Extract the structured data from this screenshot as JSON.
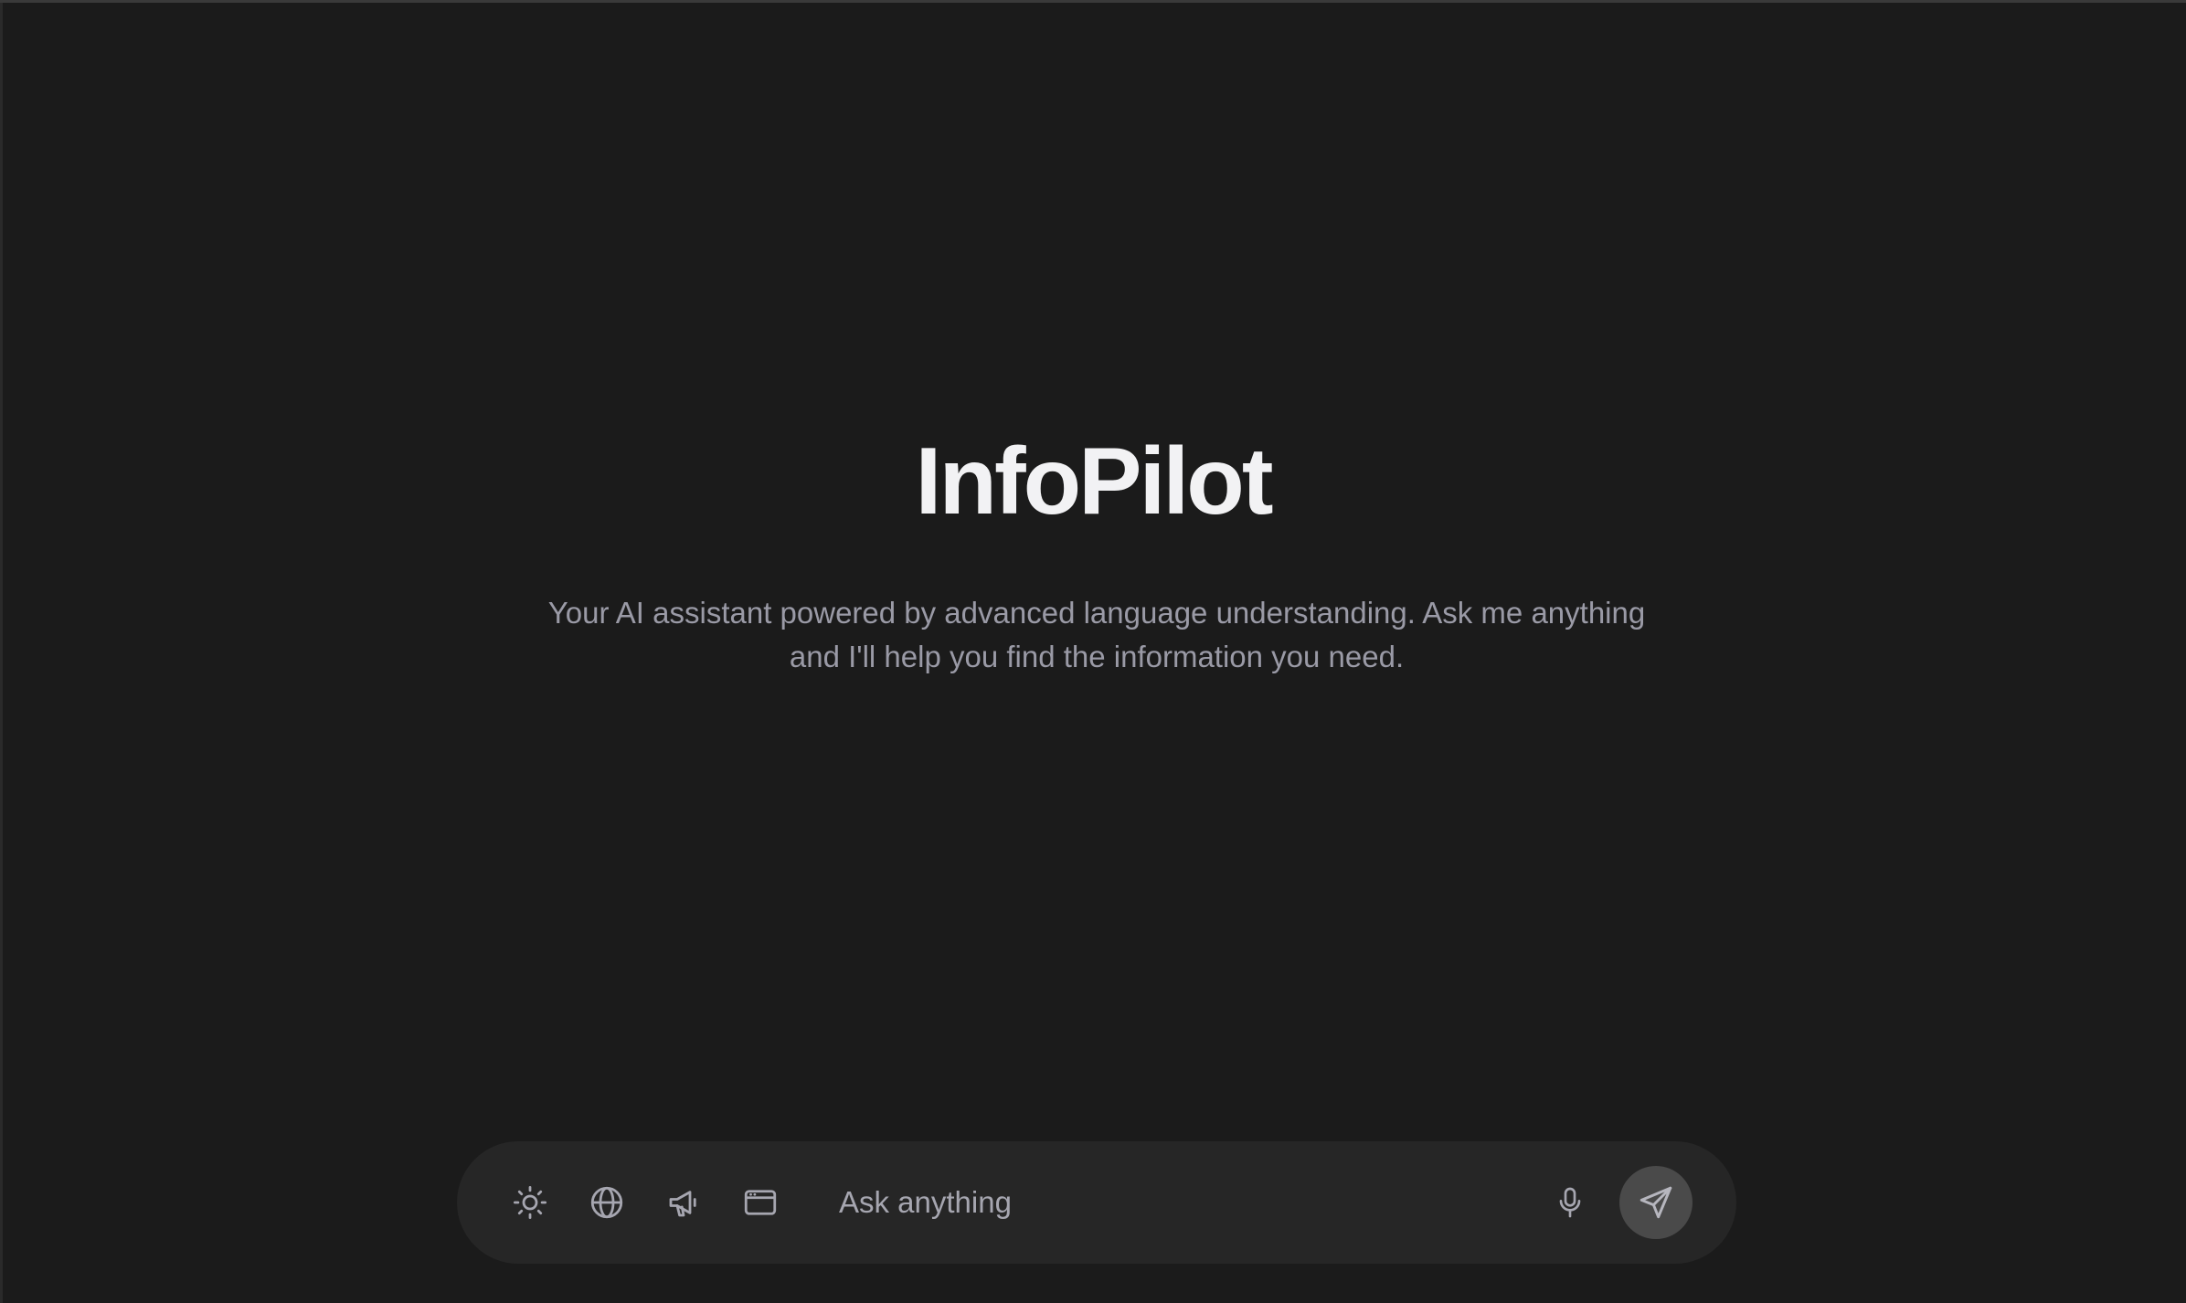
{
  "hero": {
    "title": "InfoPilot",
    "subtitle_line1": "Your AI assistant powered by advanced language understanding. Ask me anything",
    "subtitle_line2": "and I'll help you find the information you need."
  },
  "composer": {
    "placeholder": "Ask anything",
    "tools": [
      {
        "icon": "sun-icon"
      },
      {
        "icon": "globe-icon"
      },
      {
        "icon": "megaphone-icon"
      },
      {
        "icon": "browser-window-icon"
      }
    ],
    "mic_icon": "microphone-icon",
    "send_icon": "send-icon"
  },
  "colors": {
    "background": "#1b1b1b",
    "composer_bg": "#262626",
    "title": "#f2f2f4",
    "subtitle": "#9a9aa6",
    "icon": "#a6a6b0",
    "send_bg": "#4a4a4a"
  }
}
